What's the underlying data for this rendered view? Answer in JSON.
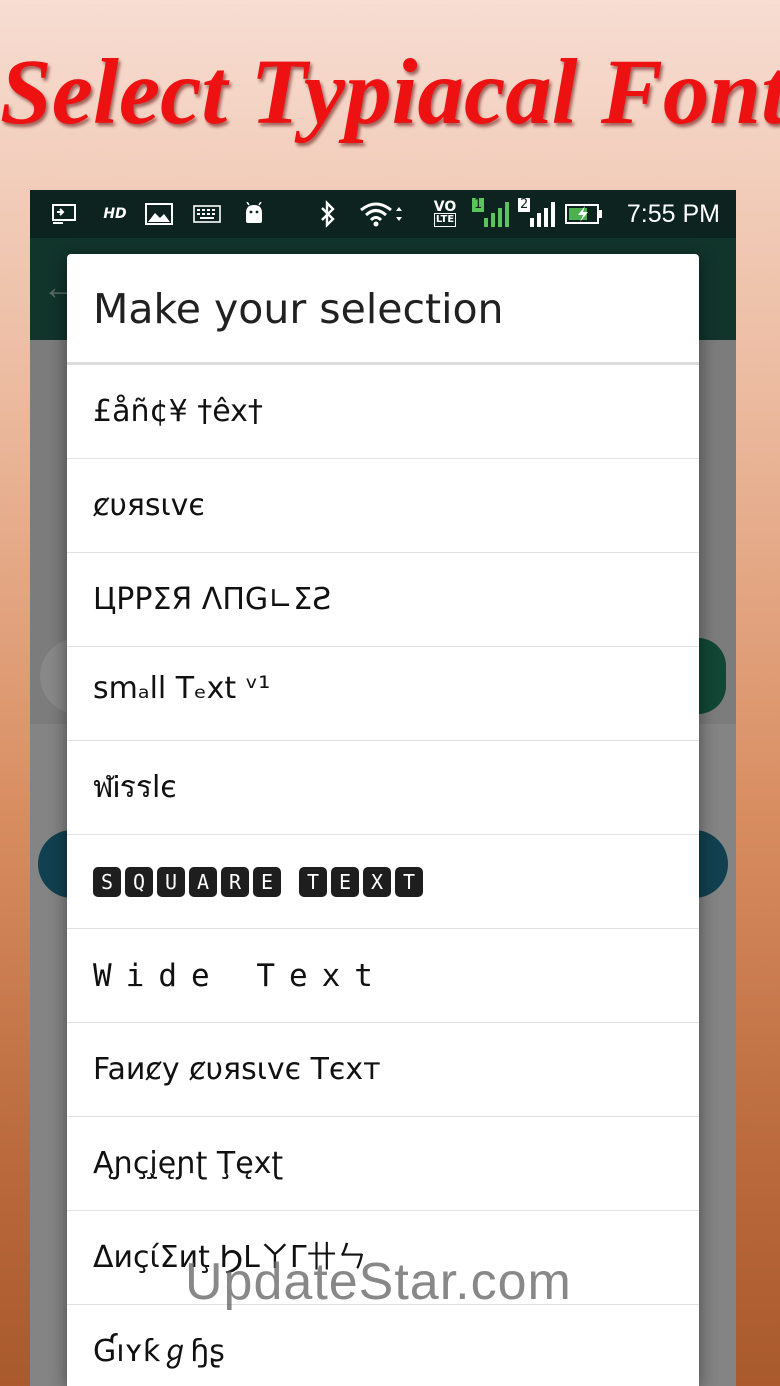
{
  "promo": {
    "title": "Select Typiacal Font"
  },
  "status_bar": {
    "time": "7:55 PM",
    "icons": [
      "screen-cast-icon",
      "hd-icon",
      "image-icon",
      "keyboard-icon",
      "android-icon",
      "bluetooth-icon",
      "wifi-icon",
      "volte-icon",
      "signal-sim1-icon",
      "signal-sim2-icon",
      "battery-charging-icon"
    ],
    "hd_label": "HD",
    "volte_label": "VO",
    "lte_label": "LTE",
    "sim1_label": "1",
    "sim2_label": "2"
  },
  "dialog": {
    "title": "Make your selection",
    "options": [
      {
        "label": "£åñ¢¥ †êx†"
      },
      {
        "label": "ȼυяѕιvє"
      },
      {
        "label": "ЦΡΡΣЯ ΛΠG∟ΣƧ"
      },
      {
        "label": "smₐll Tₑxt ᵛ¹"
      },
      {
        "label": "ฬᎥรรlє"
      },
      {
        "label": "SQUARE TEXT",
        "letters": [
          "S",
          "Q",
          "U",
          "A",
          "R",
          "E",
          " ",
          "T",
          "E",
          "X",
          "T"
        ]
      },
      {
        "label": "Wide Text"
      },
      {
        "label": "Faиȼy ȼυяѕιvє Tєxт"
      },
      {
        "label": "Ąɲçį̧ęɲʈ Ţęxʈ"
      },
      {
        "label": "ΔиçίΣиţ ϦᒪㄚΓ卄ㄣ"
      },
      {
        "label": "Ɠıʏƙℊɧʂ"
      }
    ]
  },
  "watermark": "UpdateStar.com",
  "colors": {
    "promo_title": "#ee1111",
    "status_bar": "#0d231f",
    "app_bar": "#1e5a4a",
    "accent_teal": "#1e6f8a",
    "battery": "#4caf50"
  }
}
